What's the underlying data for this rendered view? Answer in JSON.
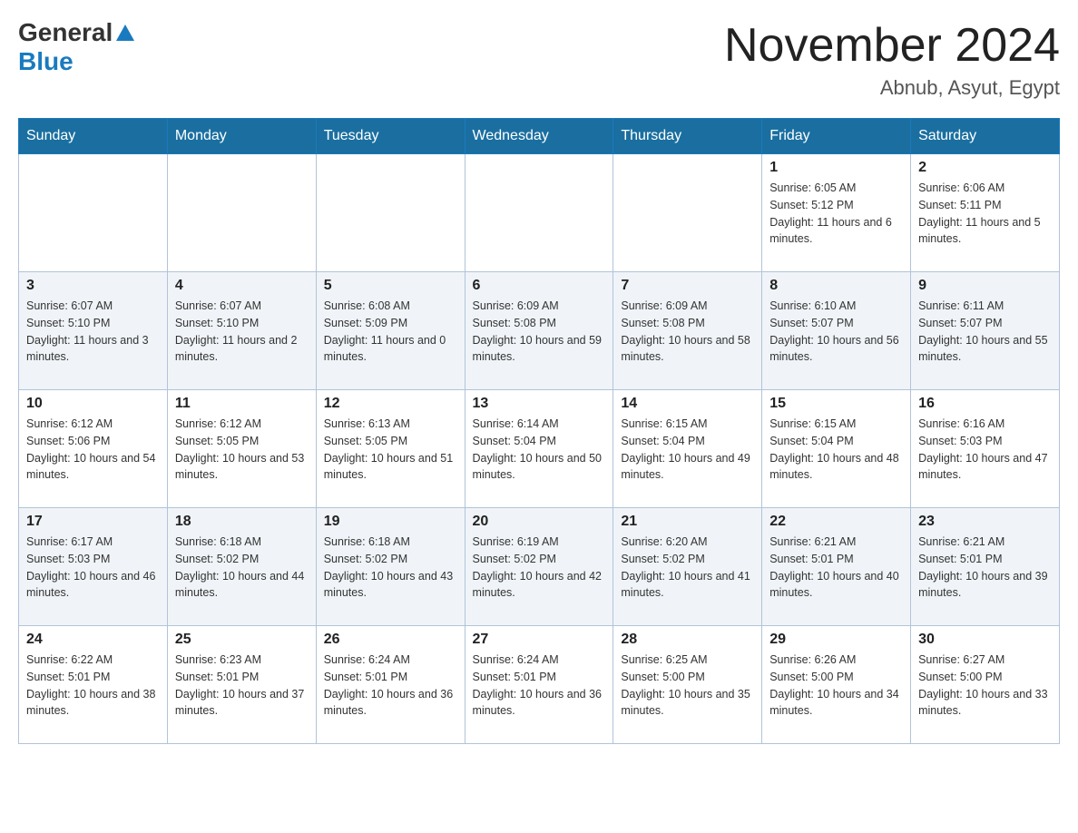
{
  "header": {
    "logo_general": "General",
    "logo_blue": "Blue",
    "month_title": "November 2024",
    "location": "Abnub, Asyut, Egypt"
  },
  "days_of_week": [
    "Sunday",
    "Monday",
    "Tuesday",
    "Wednesday",
    "Thursday",
    "Friday",
    "Saturday"
  ],
  "weeks": [
    [
      {
        "day": "",
        "info": ""
      },
      {
        "day": "",
        "info": ""
      },
      {
        "day": "",
        "info": ""
      },
      {
        "day": "",
        "info": ""
      },
      {
        "day": "",
        "info": ""
      },
      {
        "day": "1",
        "info": "Sunrise: 6:05 AM\nSunset: 5:12 PM\nDaylight: 11 hours and 6 minutes."
      },
      {
        "day": "2",
        "info": "Sunrise: 6:06 AM\nSunset: 5:11 PM\nDaylight: 11 hours and 5 minutes."
      }
    ],
    [
      {
        "day": "3",
        "info": "Sunrise: 6:07 AM\nSunset: 5:10 PM\nDaylight: 11 hours and 3 minutes."
      },
      {
        "day": "4",
        "info": "Sunrise: 6:07 AM\nSunset: 5:10 PM\nDaylight: 11 hours and 2 minutes."
      },
      {
        "day": "5",
        "info": "Sunrise: 6:08 AM\nSunset: 5:09 PM\nDaylight: 11 hours and 0 minutes."
      },
      {
        "day": "6",
        "info": "Sunrise: 6:09 AM\nSunset: 5:08 PM\nDaylight: 10 hours and 59 minutes."
      },
      {
        "day": "7",
        "info": "Sunrise: 6:09 AM\nSunset: 5:08 PM\nDaylight: 10 hours and 58 minutes."
      },
      {
        "day": "8",
        "info": "Sunrise: 6:10 AM\nSunset: 5:07 PM\nDaylight: 10 hours and 56 minutes."
      },
      {
        "day": "9",
        "info": "Sunrise: 6:11 AM\nSunset: 5:07 PM\nDaylight: 10 hours and 55 minutes."
      }
    ],
    [
      {
        "day": "10",
        "info": "Sunrise: 6:12 AM\nSunset: 5:06 PM\nDaylight: 10 hours and 54 minutes."
      },
      {
        "day": "11",
        "info": "Sunrise: 6:12 AM\nSunset: 5:05 PM\nDaylight: 10 hours and 53 minutes."
      },
      {
        "day": "12",
        "info": "Sunrise: 6:13 AM\nSunset: 5:05 PM\nDaylight: 10 hours and 51 minutes."
      },
      {
        "day": "13",
        "info": "Sunrise: 6:14 AM\nSunset: 5:04 PM\nDaylight: 10 hours and 50 minutes."
      },
      {
        "day": "14",
        "info": "Sunrise: 6:15 AM\nSunset: 5:04 PM\nDaylight: 10 hours and 49 minutes."
      },
      {
        "day": "15",
        "info": "Sunrise: 6:15 AM\nSunset: 5:04 PM\nDaylight: 10 hours and 48 minutes."
      },
      {
        "day": "16",
        "info": "Sunrise: 6:16 AM\nSunset: 5:03 PM\nDaylight: 10 hours and 47 minutes."
      }
    ],
    [
      {
        "day": "17",
        "info": "Sunrise: 6:17 AM\nSunset: 5:03 PM\nDaylight: 10 hours and 46 minutes."
      },
      {
        "day": "18",
        "info": "Sunrise: 6:18 AM\nSunset: 5:02 PM\nDaylight: 10 hours and 44 minutes."
      },
      {
        "day": "19",
        "info": "Sunrise: 6:18 AM\nSunset: 5:02 PM\nDaylight: 10 hours and 43 minutes."
      },
      {
        "day": "20",
        "info": "Sunrise: 6:19 AM\nSunset: 5:02 PM\nDaylight: 10 hours and 42 minutes."
      },
      {
        "day": "21",
        "info": "Sunrise: 6:20 AM\nSunset: 5:02 PM\nDaylight: 10 hours and 41 minutes."
      },
      {
        "day": "22",
        "info": "Sunrise: 6:21 AM\nSunset: 5:01 PM\nDaylight: 10 hours and 40 minutes."
      },
      {
        "day": "23",
        "info": "Sunrise: 6:21 AM\nSunset: 5:01 PM\nDaylight: 10 hours and 39 minutes."
      }
    ],
    [
      {
        "day": "24",
        "info": "Sunrise: 6:22 AM\nSunset: 5:01 PM\nDaylight: 10 hours and 38 minutes."
      },
      {
        "day": "25",
        "info": "Sunrise: 6:23 AM\nSunset: 5:01 PM\nDaylight: 10 hours and 37 minutes."
      },
      {
        "day": "26",
        "info": "Sunrise: 6:24 AM\nSunset: 5:01 PM\nDaylight: 10 hours and 36 minutes."
      },
      {
        "day": "27",
        "info": "Sunrise: 6:24 AM\nSunset: 5:01 PM\nDaylight: 10 hours and 36 minutes."
      },
      {
        "day": "28",
        "info": "Sunrise: 6:25 AM\nSunset: 5:00 PM\nDaylight: 10 hours and 35 minutes."
      },
      {
        "day": "29",
        "info": "Sunrise: 6:26 AM\nSunset: 5:00 PM\nDaylight: 10 hours and 34 minutes."
      },
      {
        "day": "30",
        "info": "Sunrise: 6:27 AM\nSunset: 5:00 PM\nDaylight: 10 hours and 33 minutes."
      }
    ]
  ]
}
